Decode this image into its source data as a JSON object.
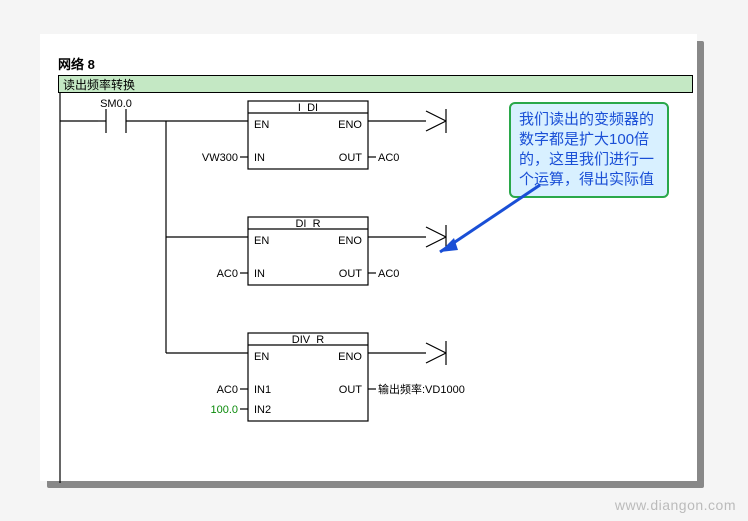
{
  "network": {
    "label": "网络 8",
    "comment": "读出频率转换"
  },
  "contact": {
    "address": "SM0.0"
  },
  "blocks": {
    "b1": {
      "title": "I_DI",
      "en": "EN",
      "eno": "ENO",
      "in": "IN",
      "out": "OUT",
      "in_val": "VW300",
      "out_val": "AC0"
    },
    "b2": {
      "title": "DI_R",
      "en": "EN",
      "eno": "ENO",
      "in": "IN",
      "out": "OUT",
      "in_val": "AC0",
      "out_val": "AC0"
    },
    "b3": {
      "title": "DIV_R",
      "en": "EN",
      "eno": "ENO",
      "in1": "IN1",
      "in2": "IN2",
      "out": "OUT",
      "in1_val": "AC0",
      "in2_val": "100.0",
      "out_label": "输出频率:VD1000"
    }
  },
  "callout": {
    "line1": "我们读出的变频器的",
    "line2a": "数字都是扩大",
    "line2b": "100",
    "line2c": "倍",
    "line3": "的，这里我们进行一",
    "line4": "个运算，得出实际值"
  },
  "watermark": "www.diangon.com"
}
